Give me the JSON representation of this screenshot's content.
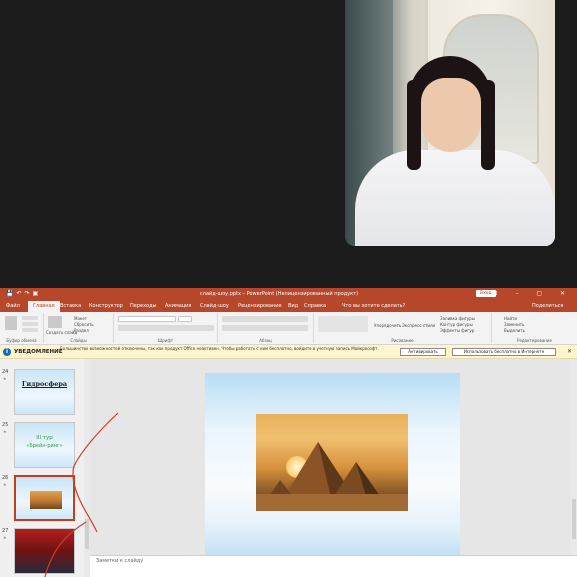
{
  "titlebar": {
    "title": "слайд-шоу.pptx  –  PowerPoint (Нелицензированный продукт)",
    "signin": "Вход",
    "controls": "⊟  –  ▢  ✕"
  },
  "tabs": [
    {
      "label": "Файл"
    },
    {
      "label": "Главная"
    },
    {
      "label": "Вставка"
    },
    {
      "label": "Конструктор"
    },
    {
      "label": "Переходы"
    },
    {
      "label": "Анимация"
    },
    {
      "label": "Слайд-шоу"
    },
    {
      "label": "Рецензирование"
    },
    {
      "label": "Вид"
    },
    {
      "label": "Справка"
    }
  ],
  "tellme": "Что вы хотите сделать?",
  "share": "Поделиться",
  "ribbon_groups": {
    "clipboard": "Буфер обмена",
    "slides": "Слайды",
    "font": "Шрифт",
    "paragraph": "Абзац",
    "drawing": "Рисование",
    "editing": "Редактирование"
  },
  "ribbon_labels": {
    "create_slide": "Создать слайд",
    "layout": "Макет",
    "reset": "Сбросить",
    "section": "Раздел",
    "find": "Найти",
    "replace": "Заменить",
    "select": "Выделить",
    "fill": "Заливка фигуры",
    "outline": "Контур фигуры",
    "effects": "Эффекты фигур",
    "quick_styles": "Экспресс-стили",
    "arrange": "Упорядочить"
  },
  "infobar": {
    "title": "УВЕДОМЛЕНИЕ",
    "message": "Большинство возможностей отключены, так как продукт Office неактивен. Чтобы работать с ним бесплатно, войдите в учетную запись Майкрософт.",
    "activate_button": "Активировать",
    "free_button": "Использовать бесплатно в Интернете"
  },
  "slides": [
    {
      "number": "24",
      "title": "Гидросфера"
    },
    {
      "number": "25",
      "line1": "III тур",
      "line2": "«Брейн-ринг»"
    },
    {
      "number": "26"
    },
    {
      "number": "27"
    }
  ],
  "notes_placeholder": "Заметки к слайду",
  "colors": {
    "accent": "#b7472a",
    "selection": "#c43e1c",
    "info_bg": "#fff4ce"
  }
}
